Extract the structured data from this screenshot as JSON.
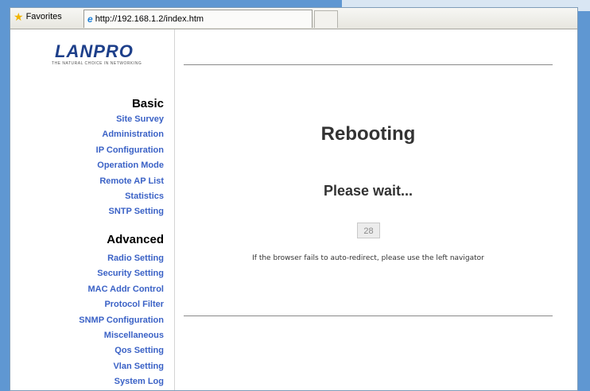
{
  "browser": {
    "favorites_label": "Favorites",
    "tab_url": "http://192.168.1.2/index.htm"
  },
  "brand": {
    "logo_text": "LANPRO",
    "tagline": "THE NATURAL CHOICE IN NETWORKING"
  },
  "sidebar": {
    "basic_heading": "Basic",
    "basic_items": [
      "Site Survey",
      "Administration",
      "IP Configuration",
      "Operation Mode",
      "Remote AP List",
      "Statistics",
      "SNTP Setting"
    ],
    "advanced_heading": "Advanced",
    "advanced_items": [
      "Radio Setting",
      "Security Setting",
      "MAC Addr Control",
      "Protocol Filter",
      "SNMP Configuration",
      "Miscellaneous",
      "Qos Setting",
      "Vlan Setting",
      "System Log"
    ]
  },
  "main": {
    "title": "Rebooting",
    "subtitle": "Please wait...",
    "countdown": "28",
    "hint": "If the browser fails to auto-redirect, please use the left navigator"
  }
}
